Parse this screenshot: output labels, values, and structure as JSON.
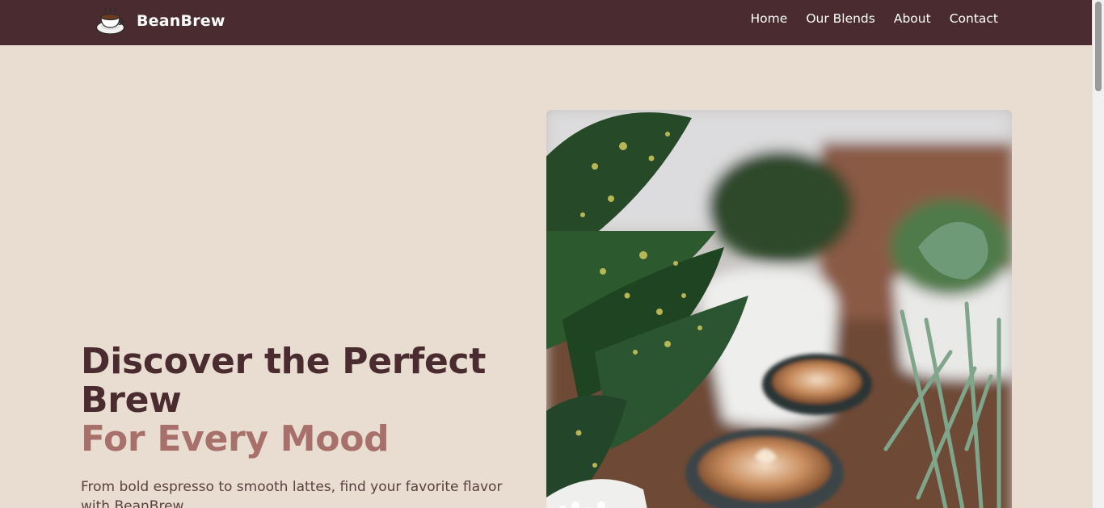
{
  "navbar": {
    "brand_name": "BeanBrew",
    "logo_icon": "coffee-cup-icon",
    "links": [
      {
        "label": "Home"
      },
      {
        "label": "Our Blends"
      },
      {
        "label": "About"
      },
      {
        "label": "Contact"
      }
    ]
  },
  "hero": {
    "title_line1": "Discover the Perfect Brew",
    "title_line2": "For Every Mood",
    "description": "From bold espresso to smooth lattes, find your favorite flavor with BeanBrew."
  },
  "colors": {
    "navbar_bg": "#4a2c30",
    "page_bg": "#e8ddd0",
    "title_primary": "#4a2c30",
    "title_accent": "#a8706a",
    "body_text": "#5a4040"
  }
}
